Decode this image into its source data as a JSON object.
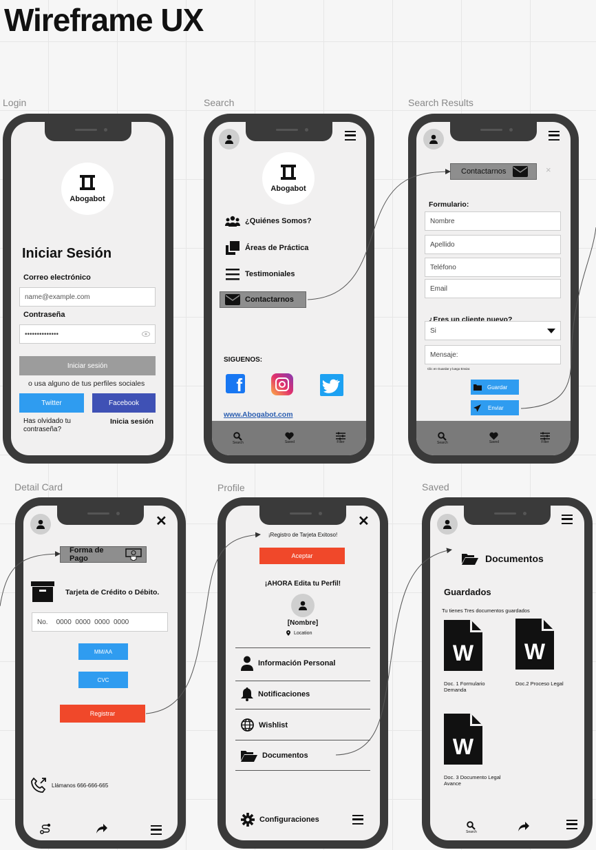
{
  "title": "Wireframe UX",
  "frames": {
    "login": "Login",
    "search": "Search",
    "results": "Search Results",
    "detail": "Detail Card",
    "profile": "Profile",
    "saved": "Saved"
  },
  "brand": "Abogabot",
  "login": {
    "heading": "Iniciar Sesión",
    "email_label": "Correo electrónico",
    "email_placeholder": "name@example.com",
    "password_label": "Contraseña",
    "password_value": "••••••••••••••",
    "submit": "Iniciar sesión",
    "social_text": "o usa alguno de tus perfiles sociales",
    "twitter": "Twitter",
    "facebook": "Facebook",
    "forgot": "Has olvidado tu contraseña?",
    "signin_link": "Inicia sesión"
  },
  "search": {
    "menu": [
      "¿Quiénes Somos?",
      "Áreas de Práctica",
      "Testimoniales",
      "Contactarnos"
    ],
    "follow": "SIGUENOS:",
    "website": "www.Abogabot.com"
  },
  "nav": {
    "search": "Search",
    "saved": "Saved",
    "filter": "Filter"
  },
  "results": {
    "header": "Contactarnos",
    "close": "×",
    "form_label": "Formulario:",
    "fields": [
      "Nombre",
      "Apellido",
      "Teléfono",
      "Email"
    ],
    "question": "¿Eres un cliente nuevo?",
    "select_value": "Si",
    "message": "Mensaje:",
    "hint": "Clic en Guardar y luego Enviar.",
    "save": "Guardar",
    "send": "Enviar"
  },
  "detail": {
    "header": "Forma de Pago",
    "card_text": "Tarjeta de Crédito o Débito.",
    "card_number_label": "No.",
    "card_number": "0000  0000  0000  0000",
    "expiry": "MM/AA",
    "cvc": "CVC",
    "register": "Registrar",
    "call": "Llámanos  666-666-665"
  },
  "profile": {
    "success": "¡Registro de Tarjeta Exitoso!",
    "accept": "Aceptar",
    "edit": "¡AHORA Edita tu Perfil!",
    "name": "[Nombre]",
    "location": "Location",
    "menu": [
      "Información Personal",
      "Notificaciones",
      "Wishlist",
      "Documentos"
    ],
    "settings": "Configuraciones"
  },
  "saved": {
    "header": "Documentos",
    "heading": "Guardados",
    "subtitle": "Tu tienes Tres documentos guardados",
    "docs": [
      "Doc. 1 Formulario Demanda",
      "Doc.2 Proceso Legal",
      "Doc. 3 Documento Legal Avance"
    ],
    "doc_letter": "W",
    "nav_search": "Search"
  },
  "colors": {
    "blue": "#2f9cf0",
    "navy": "#3f51b5",
    "red": "#f0482a",
    "frame": "#3a3a3a",
    "nav": "#7a7a7a"
  }
}
